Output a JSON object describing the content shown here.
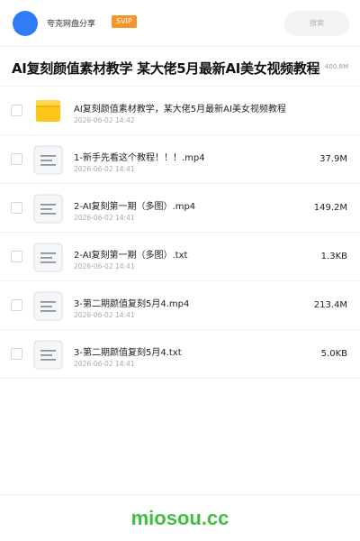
{
  "header": {
    "site_name": "夸克网盘分享",
    "badge": "SVIP",
    "search_placeholder": "搜索",
    "avatar_color": "#2f7df6",
    "badge_color": "#f5962b"
  },
  "share": {
    "title": "AI复刻颜值素材教学 某大佬5月最新AI美女视频教程",
    "total_size": "400.6M"
  },
  "files": [
    {
      "type": "folder-icon",
      "name": "AI复刻颜值素材教学，某大佬5月最新AI美女视频教程",
      "date": "2026-06-02 14:42",
      "size": ""
    },
    {
      "type": "document-icon",
      "name": "1-新手先看这个教程！！！.mp4",
      "date": "2026-06-02 14:41",
      "size": "37.9M"
    },
    {
      "type": "document-icon",
      "name": "2-AI复刻第一期（多图）.mp4",
      "date": "2026-06-02 14:41",
      "size": "149.2M"
    },
    {
      "type": "document-icon",
      "name": "2-AI复刻第一期（多图）.txt",
      "date": "2026-06-02 14:41",
      "size": "1.3KB"
    },
    {
      "type": "document-icon",
      "name": "3-第二期颜值复刻5月4.mp4",
      "date": "2026-06-02 14:41",
      "size": "213.4M"
    },
    {
      "type": "document-icon",
      "name": "3-第二期颜值复刻5月4.txt",
      "date": "2026-06-02 14:41",
      "size": "5.0KB"
    }
  ],
  "footer": {
    "brand": "miosou.cc",
    "brand_color": "#3fbf3f"
  }
}
